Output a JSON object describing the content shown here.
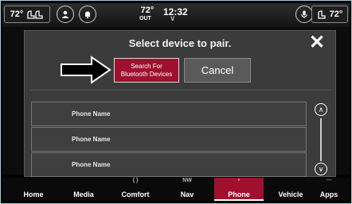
{
  "status_bar": {
    "left_temp": "72°",
    "right_temp": "72°",
    "outside_temp": "72°",
    "outside_label": "OUT",
    "clock": "12:32"
  },
  "dialog": {
    "title": "Select device to pair.",
    "search_button_line1": "Search For",
    "search_button_line2": "Bluetooth Devices",
    "cancel_label": "Cancel",
    "close_icon": "close-icon"
  },
  "phones": [
    {
      "name": "Phone Name"
    },
    {
      "name": "Phone Name"
    },
    {
      "name": "Phone Name"
    }
  ],
  "nav": {
    "items": [
      {
        "label": "Home"
      },
      {
        "label": "Media"
      },
      {
        "label": "Comfort"
      },
      {
        "label": "Nav"
      },
      {
        "label": "Phone"
      },
      {
        "label": "Vehicle"
      },
      {
        "label": "Apps"
      }
    ],
    "active": "Phone"
  },
  "colors": {
    "accent": "#a0102e",
    "frame": "#9fd0d6"
  }
}
